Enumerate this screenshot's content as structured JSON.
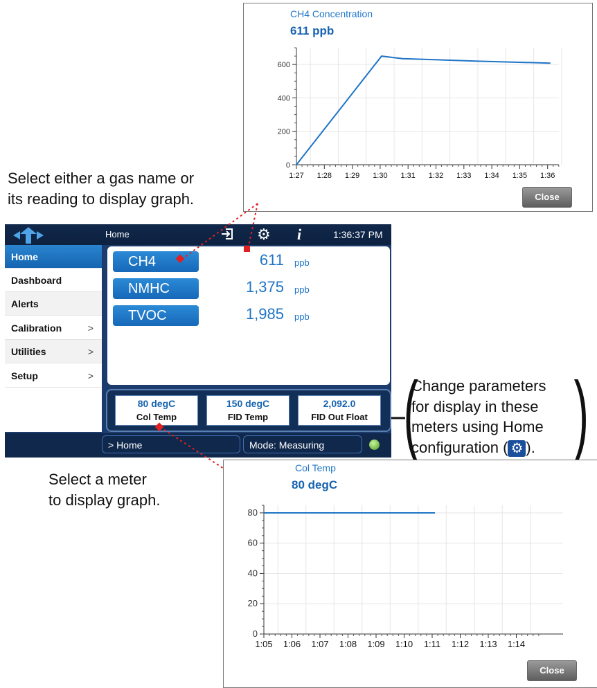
{
  "popup_top": {
    "title": "CH4 Concentration",
    "value": "611 ppb",
    "close_label": "Close"
  },
  "popup_bottom": {
    "title": "Col Temp",
    "value": "80 degC",
    "close_label": "Close"
  },
  "annotations": {
    "select_gas_line1": "Select either a gas name or",
    "select_gas_line2": "its reading to display graph.",
    "select_meter_line1": "Select a meter",
    "select_meter_line2": "to display graph.",
    "change_line1": "Change parameters",
    "change_line2": "for display in these",
    "change_line3": "meters using Home",
    "change_line4_a": "configuration (",
    "change_line4_b": ")."
  },
  "topbar": {
    "title": "Home",
    "time": "1:36:37 PM",
    "icons": [
      "logout-icon",
      "gear-icon",
      "info-icon"
    ]
  },
  "sidebar": {
    "items": [
      {
        "label": "Home",
        "chevron": ""
      },
      {
        "label": "Dashboard",
        "chevron": ""
      },
      {
        "label": "Alerts",
        "chevron": ""
      },
      {
        "label": "Calibration",
        "chevron": ">"
      },
      {
        "label": "Utilities",
        "chevron": ">"
      },
      {
        "label": "Setup",
        "chevron": ">"
      }
    ]
  },
  "readings": [
    {
      "name": "CH4",
      "value": "611",
      "unit": "ppb"
    },
    {
      "name": "NMHC",
      "value": "1,375",
      "unit": "ppb"
    },
    {
      "name": "TVOC",
      "value": "1,985",
      "unit": "ppb"
    }
  ],
  "meters": [
    {
      "value": "80 degC",
      "label": "Col Temp"
    },
    {
      "value": "150 degC",
      "label": "FID Temp"
    },
    {
      "value": "2,092.0",
      "label": "FID Out Float"
    }
  ],
  "status": {
    "breadcrumb": "> Home",
    "mode": "Mode: Measuring"
  },
  "colors": {
    "accent": "#1e74c6",
    "header_bg": "#10284b",
    "status_led": "#4e9a22"
  },
  "chart_data": [
    {
      "type": "line",
      "title": "CH4 Concentration",
      "x": [
        "1:27",
        "1:28",
        "1:29",
        "1:30",
        "1:31",
        "1:32",
        "1:33",
        "1:34",
        "1:35",
        "1:36"
      ],
      "series": [
        {
          "points": [
            [
              0.0,
              0
            ],
            [
              3.05,
              650
            ],
            [
              3.8,
              635
            ],
            [
              6.5,
              620
            ],
            [
              9.1,
              608
            ]
          ]
        }
      ],
      "y_ticks": [
        "0",
        "200",
        "400",
        "600"
      ],
      "ylim": [
        0,
        700
      ],
      "grid": true
    },
    {
      "type": "line",
      "title": "Col Temp",
      "x": [
        "1:05",
        "1:06",
        "1:07",
        "1:08",
        "1:09",
        "1:10",
        "1:11",
        "1:12",
        "1:13",
        "1:14"
      ],
      "series": [
        {
          "points": [
            [
              0.0,
              80
            ],
            [
              6.1,
              80
            ]
          ]
        }
      ],
      "y_ticks": [
        "0",
        "20",
        "40",
        "60",
        "80"
      ],
      "ylim": [
        0,
        85
      ],
      "grid": true
    }
  ]
}
